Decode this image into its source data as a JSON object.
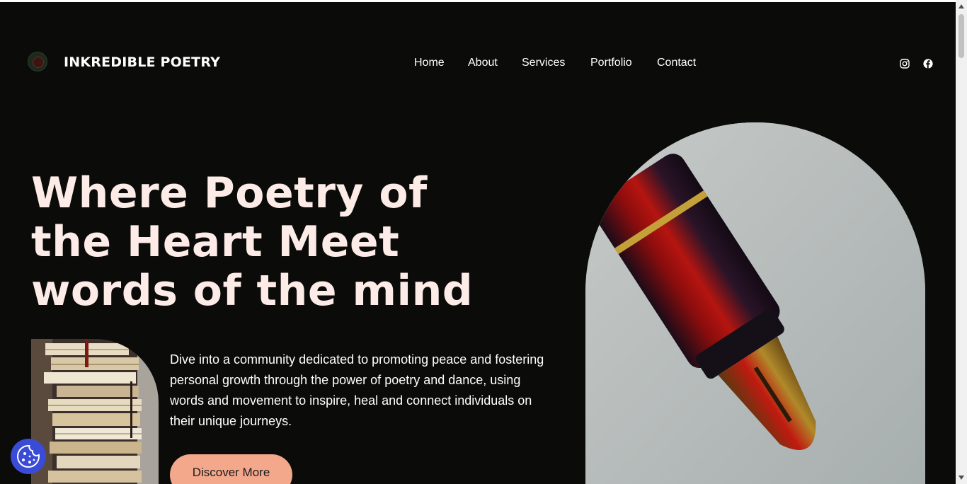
{
  "brand": {
    "name": "INKREDIBLE POETRY",
    "logo_icon": "emblem-logo"
  },
  "nav": {
    "items": [
      {
        "label": "Home"
      },
      {
        "label": "About"
      },
      {
        "label": "Services"
      },
      {
        "label": "Portfolio"
      },
      {
        "label": "Contact"
      }
    ]
  },
  "social": {
    "icons": [
      "instagram-icon",
      "facebook-icon"
    ]
  },
  "hero": {
    "title_lines": [
      "Where Poetry of",
      "the Heart Meet",
      "words of the mind"
    ],
    "description": "Dive into a community dedicated to promoting peace and fostering personal growth through the power of poetry and dance, using words and movement to inspire, heal and connect individuals on their unique journeys.",
    "cta_label": "Discover More",
    "images": [
      "stacked-books-photo",
      "fountain-pen-photo"
    ]
  },
  "cookie": {
    "icon": "cookie-icon"
  },
  "colors": {
    "background": "#0b0b0a",
    "title": "#fcebe6",
    "accent": "#f3a78b",
    "cookie_button": "#3a4bd8"
  }
}
